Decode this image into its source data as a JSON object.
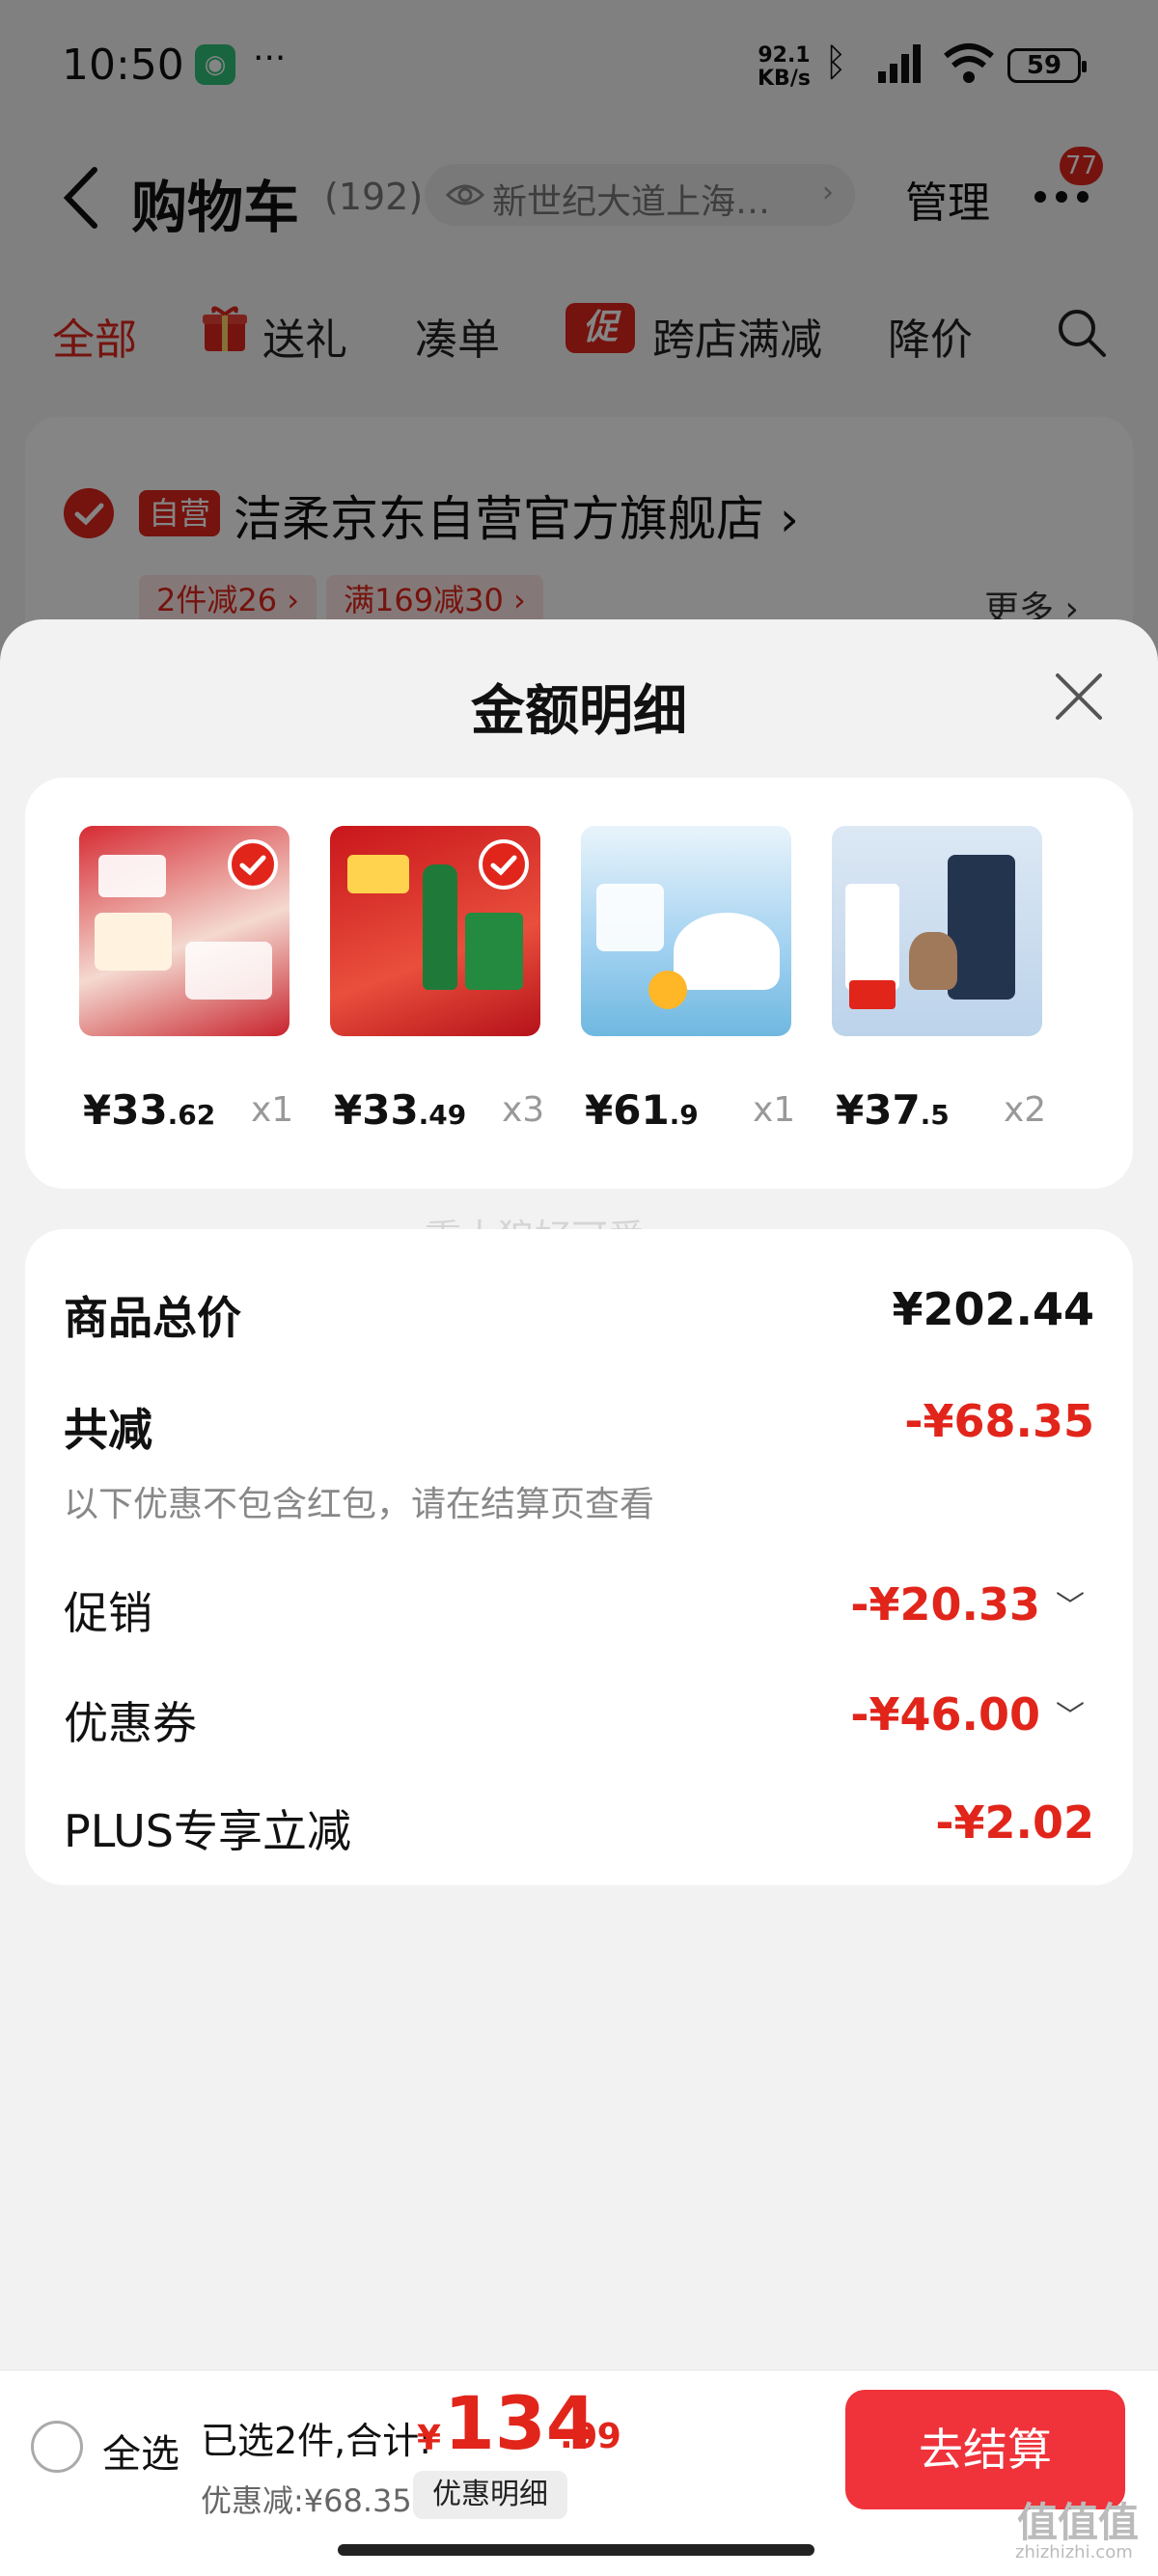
{
  "status_bar": {
    "time": "10:50",
    "dots": "···",
    "net_speed_value": "92.1",
    "net_speed_unit": "KB/s",
    "battery": "59"
  },
  "header": {
    "title": "购物车",
    "count": "(192)",
    "address": "新世纪大道上海…",
    "manage": "管理",
    "more_badge": "77"
  },
  "tabs": [
    {
      "label": "全部"
    },
    {
      "label": "送礼"
    },
    {
      "label": "凑单"
    },
    {
      "label": "跨店满减"
    },
    {
      "label": "降价"
    }
  ],
  "promo_tab_icon": "促",
  "store": {
    "badge": "自营",
    "name": "洁柔京东自营官方旗舰店 ›",
    "tags": [
      "2件减26 ›",
      "满169减30 ›"
    ],
    "more": "更多 ›"
  },
  "sheet": {
    "title": "金额明细"
  },
  "products": [
    {
      "price_int": "¥33",
      "price_dec": ".62",
      "qty": "x1",
      "checked": true,
      "icon": "tissue-product-image",
      "color": "#c8232c"
    },
    {
      "price_int": "¥33",
      "price_dec": ".49",
      "qty": "x3",
      "checked": true,
      "icon": "beer-product-image",
      "color": "#c9161c"
    },
    {
      "price_int": "¥61",
      "price_dec": ".9",
      "qty": "x1",
      "checked": false,
      "icon": "cream-product-image",
      "color": "#7cc1ea"
    },
    {
      "price_int": "¥37",
      "price_dec": ".5",
      "qty": "x2",
      "checked": false,
      "icon": "diaper-product-image",
      "color": "#bcd3ea"
    }
  ],
  "summary": {
    "total_label": "商品总价",
    "total_value": "¥202.44",
    "reduce_label": "共减",
    "reduce_value": "-¥68.35",
    "note": "以下优惠不包含红包，请在结算页查看",
    "promo_label": "促销",
    "promo_value": "-¥20.33",
    "coupon_label": "优惠券",
    "coupon_value": "-¥46.00",
    "plus_label": "PLUS专享立减",
    "plus_value": "-¥2.02",
    "chevron": "﹀"
  },
  "watermark": "熏太狼好可爱",
  "bottom_bar": {
    "select_all": "全选",
    "selected_text": "已选2件,合计:",
    "currency": "¥",
    "total_int": "134",
    "total_dec": ".09",
    "discount": "优惠减:¥68.35",
    "detail_button": "优惠明细",
    "checkout_button": "去结算",
    "corner_logo": "值值值",
    "corner_url": "zhizhizhi.com"
  },
  "colors": {
    "accent_red": "#e1251b",
    "checkout_red": "#f0323a"
  }
}
